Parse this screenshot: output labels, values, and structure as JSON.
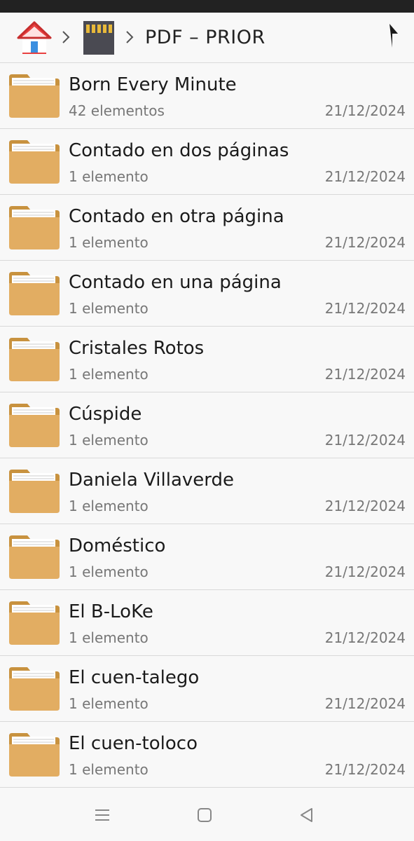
{
  "toolbar": {
    "breadcrumb_current": "PDF – PRIOR",
    "icons": [
      "home-icon",
      "sd-card-icon",
      "chevron-right-icon",
      "up-arrow-icon"
    ]
  },
  "colors": {
    "folder": "#e2ad62",
    "folder_dark": "#c8923f",
    "home_roof": "#e84040",
    "home_door": "#3b8fe0",
    "sd_card": "#4a4a52",
    "sd_contacts": "#e8b93a"
  },
  "folders": [
    {
      "name": "Born Every Minute",
      "count": "42 elementos",
      "date": "21/12/2024"
    },
    {
      "name": "Contado en dos páginas",
      "count": "1 elemento",
      "date": "21/12/2024"
    },
    {
      "name": "Contado en otra página",
      "count": "1 elemento",
      "date": "21/12/2024"
    },
    {
      "name": "Contado en una página",
      "count": "1 elemento",
      "date": "21/12/2024"
    },
    {
      "name": "Cristales Rotos",
      "count": "1 elemento",
      "date": "21/12/2024"
    },
    {
      "name": "Cúspide",
      "count": "1 elemento",
      "date": "21/12/2024"
    },
    {
      "name": "Daniela Villaverde",
      "count": "1 elemento",
      "date": "21/12/2024"
    },
    {
      "name": "Doméstico",
      "count": "1 elemento",
      "date": "21/12/2024"
    },
    {
      "name": "El B-LoKe",
      "count": "1 elemento",
      "date": "21/12/2024"
    },
    {
      "name": "El cuen-talego",
      "count": "1 elemento",
      "date": "21/12/2024"
    },
    {
      "name": "El cuen-toloco",
      "count": "1 elemento",
      "date": "21/12/2024"
    }
  ],
  "navbar": {
    "icons": [
      "menu-icon",
      "home-square-icon",
      "back-triangle-icon"
    ]
  }
}
